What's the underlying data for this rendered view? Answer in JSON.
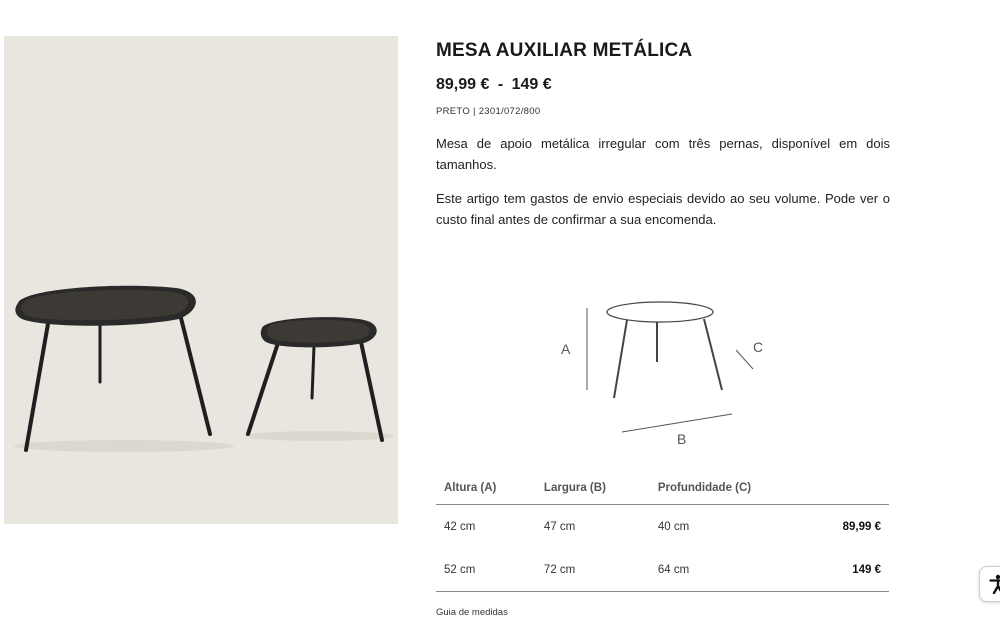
{
  "product": {
    "title": "MESA AUXILIAR METÁLICA",
    "price_min": "89,99 €",
    "price_separator": "-",
    "price_max": "149 €",
    "reference": "PRETO | 2301/072/800",
    "description": [
      "Mesa de apoio metálica irregular com três pernas, disponível em dois tamanhos.",
      "Este artigo tem gastos de envio especiais devido ao seu volume. Pode ver o custo final antes de confirmar a sua encomenda."
    ]
  },
  "diagram": {
    "label_a": "A",
    "label_b": "B",
    "label_c": "C"
  },
  "dimensions": {
    "headers": [
      "Altura (A)",
      "Largura (B)",
      "Profundidade (C)",
      ""
    ],
    "rows": [
      {
        "height": "42 cm",
        "width": "47 cm",
        "depth": "40 cm",
        "price": "89,99 €"
      },
      {
        "height": "52 cm",
        "width": "72 cm",
        "depth": "64 cm",
        "price": "149 €"
      }
    ]
  },
  "guide_link": "Guia de medidas",
  "colors": {
    "background": "#ffffff",
    "image_bg": "#e9e6df",
    "table_border": "#888888"
  },
  "icons": {
    "accessibility": "accessibility-icon"
  }
}
